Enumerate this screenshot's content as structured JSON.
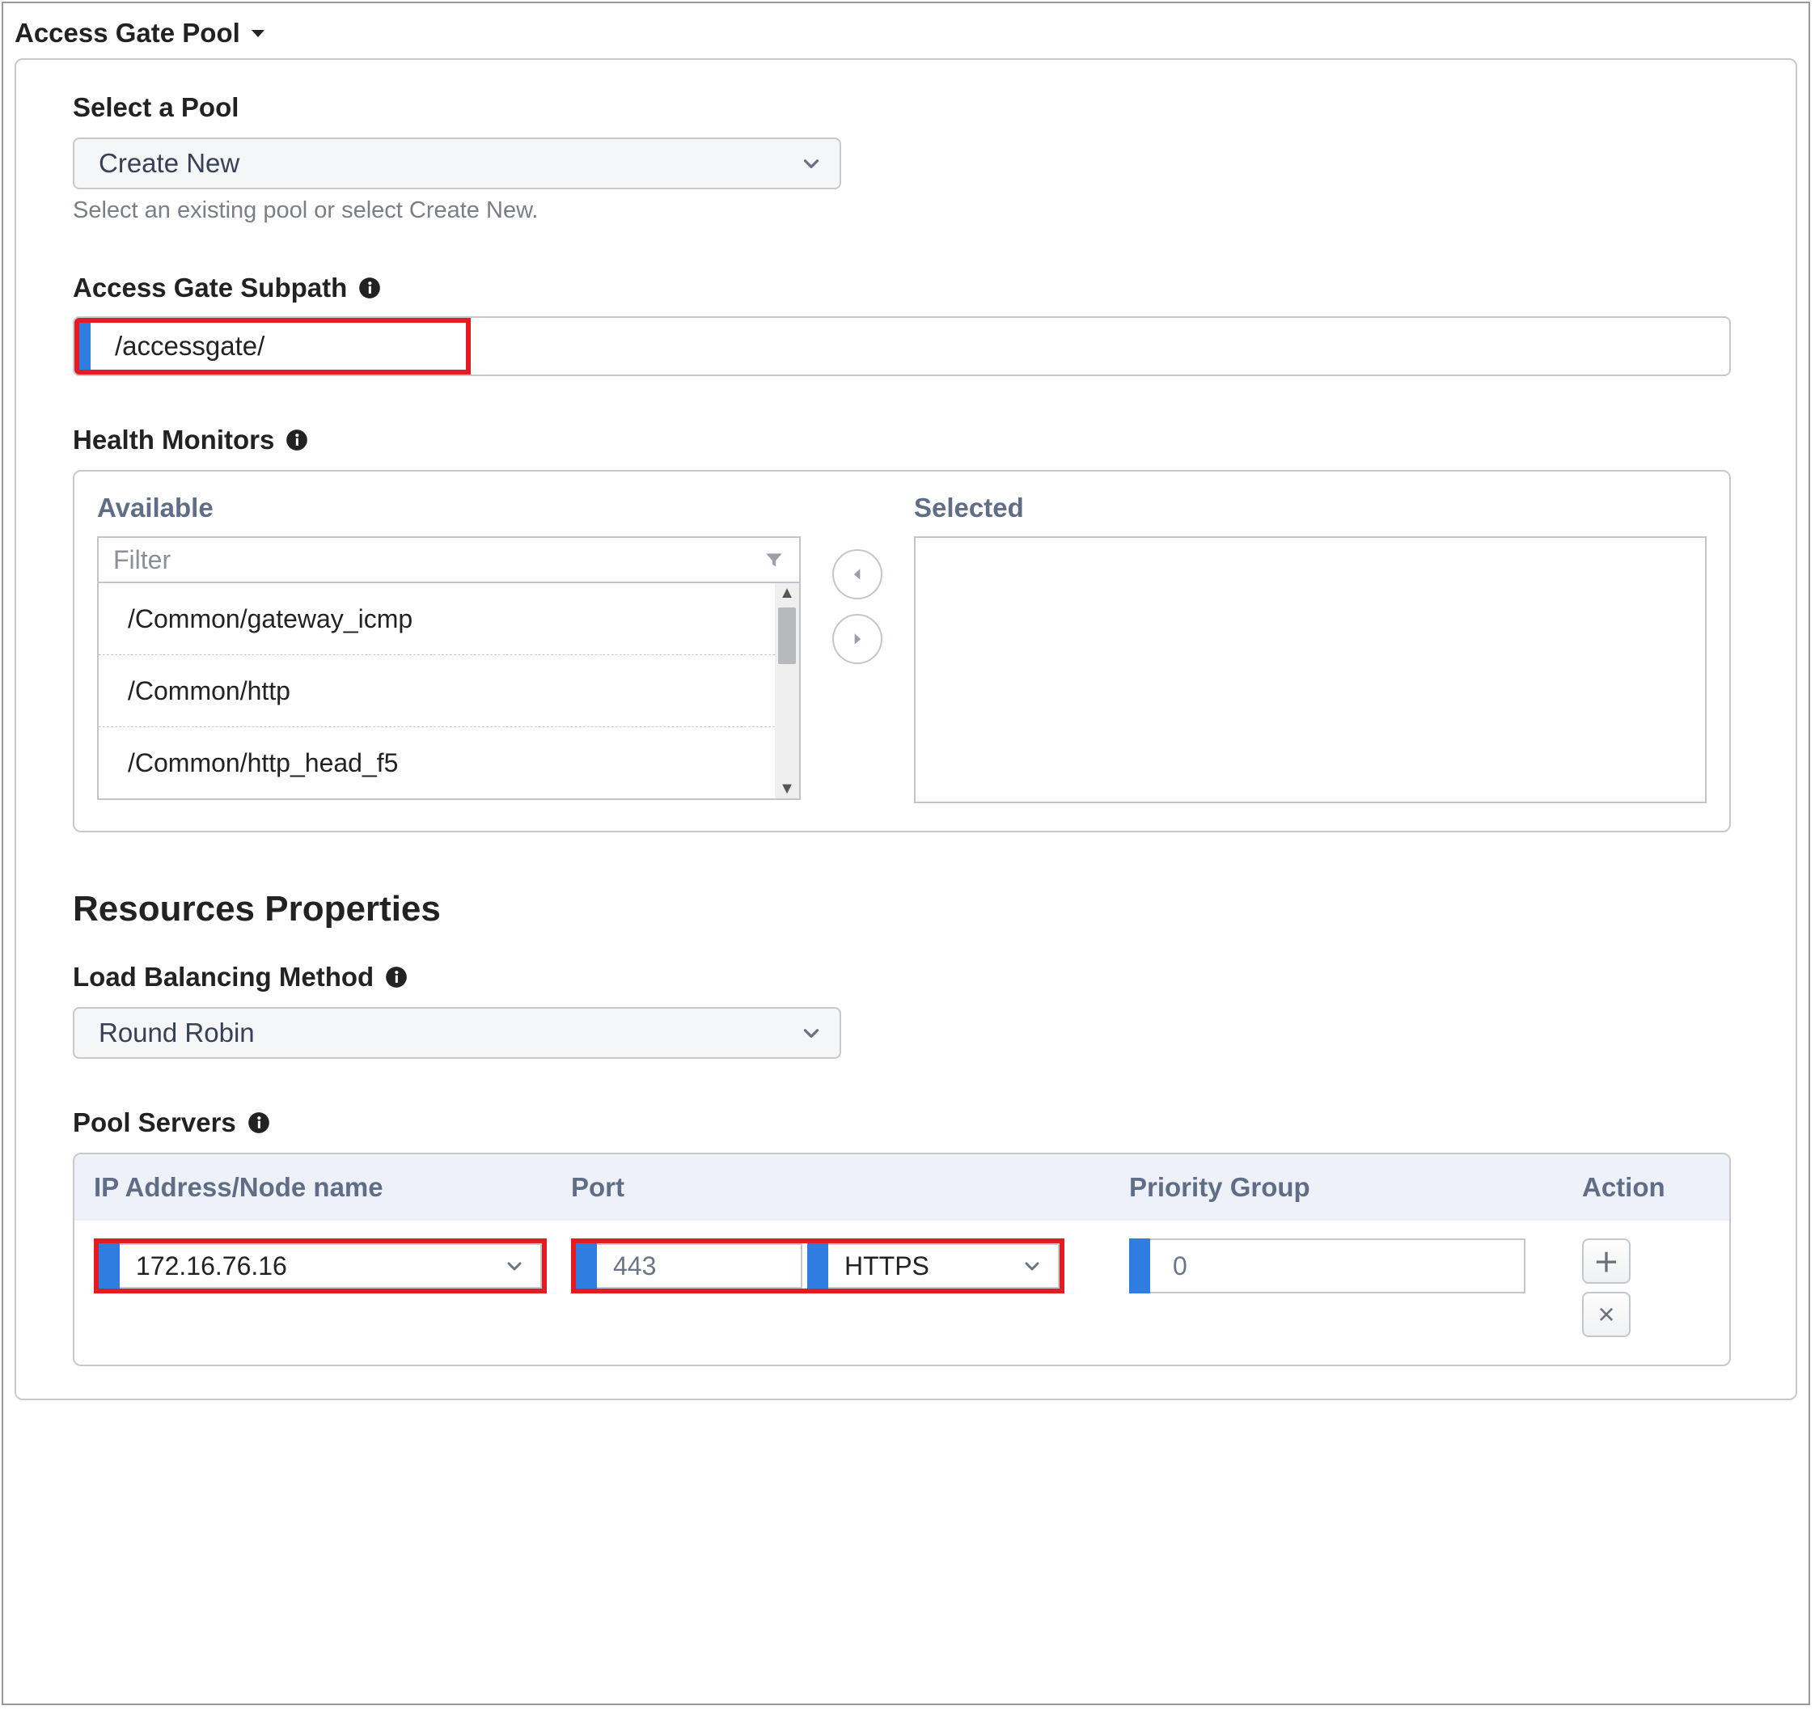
{
  "section": {
    "title": "Access Gate Pool"
  },
  "pool_select": {
    "label": "Select a Pool",
    "value": "Create New",
    "helper": "Select an existing pool or select Create New."
  },
  "subpath": {
    "label": "Access Gate Subpath",
    "value": "/accessgate/"
  },
  "health_monitors": {
    "label": "Health Monitors",
    "available_label": "Available",
    "selected_label": "Selected",
    "filter_placeholder": "Filter",
    "items": [
      "/Common/gateway_icmp",
      "/Common/http",
      "/Common/http_head_f5"
    ]
  },
  "resources": {
    "heading": "Resources Properties",
    "lbm_label": "Load Balancing Method",
    "lbm_value": "Round Robin"
  },
  "pool_servers": {
    "label": "Pool Servers",
    "columns": {
      "ip": "IP Address/Node name",
      "port": "Port",
      "priority": "Priority Group",
      "action": "Action"
    },
    "row": {
      "ip": "172.16.76.16",
      "port": "443",
      "port_proto": "HTTPS",
      "priority": "0"
    }
  }
}
